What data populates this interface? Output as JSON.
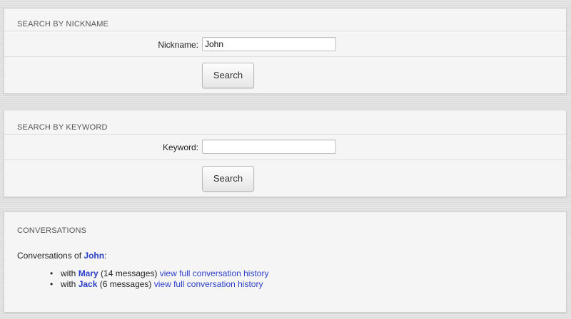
{
  "nickname_search": {
    "title": "SEARCH BY NICKNAME",
    "label": "Nickname:",
    "value": "John",
    "button": "Search"
  },
  "keyword_search": {
    "title": "SEARCH BY KEYWORD",
    "label": "Keyword:",
    "value": "",
    "button": "Search"
  },
  "conversations": {
    "title": "CONVERSATIONS",
    "intro_prefix": "Conversations of ",
    "user": "John",
    "intro_suffix": ":",
    "items": [
      {
        "with": "with ",
        "name": "Mary",
        "count": " (14 messages) ",
        "link": "view full conversation history"
      },
      {
        "with": "with ",
        "name": "Jack",
        "count": " (6 messages) ",
        "link": "view full conversation history"
      }
    ]
  },
  "colors": {
    "link": "#2b3fc9",
    "panel_bg": "#f5f5f5",
    "page_bg": "#e2e2e2"
  }
}
